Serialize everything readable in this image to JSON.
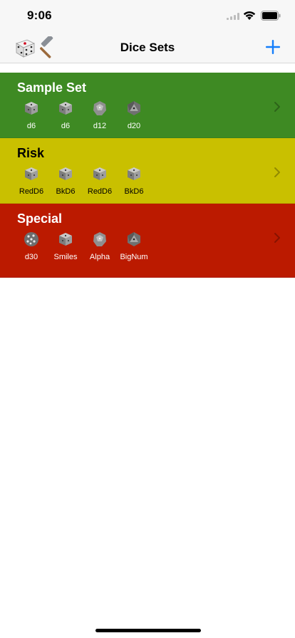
{
  "status_bar": {
    "time": "9:06"
  },
  "nav": {
    "title": "Dice Sets",
    "add_label": "+"
  },
  "sets": [
    {
      "name": "Sample Set",
      "color": "#3e8a23",
      "text_color": "#ffffff",
      "dice": [
        {
          "label": "d6",
          "shape": "d6"
        },
        {
          "label": "d6",
          "shape": "d6"
        },
        {
          "label": "d12",
          "shape": "d12"
        },
        {
          "label": "d20",
          "shape": "d20"
        }
      ]
    },
    {
      "name": "Risk",
      "color": "#c9c000",
      "text_color": "#000000",
      "dice": [
        {
          "label": "RedD6",
          "shape": "d6"
        },
        {
          "label": "BkD6",
          "shape": "d6"
        },
        {
          "label": "RedD6",
          "shape": "d6"
        },
        {
          "label": "BkD6",
          "shape": "d6"
        }
      ]
    },
    {
      "name": "Special",
      "color": "#bb1a00",
      "text_color": "#ffffff",
      "dice": [
        {
          "label": "d30",
          "shape": "d30"
        },
        {
          "label": "Smiles",
          "shape": "d6"
        },
        {
          "label": "Alpha",
          "shape": "d12"
        },
        {
          "label": "BigNum",
          "shape": "d20"
        }
      ]
    }
  ]
}
